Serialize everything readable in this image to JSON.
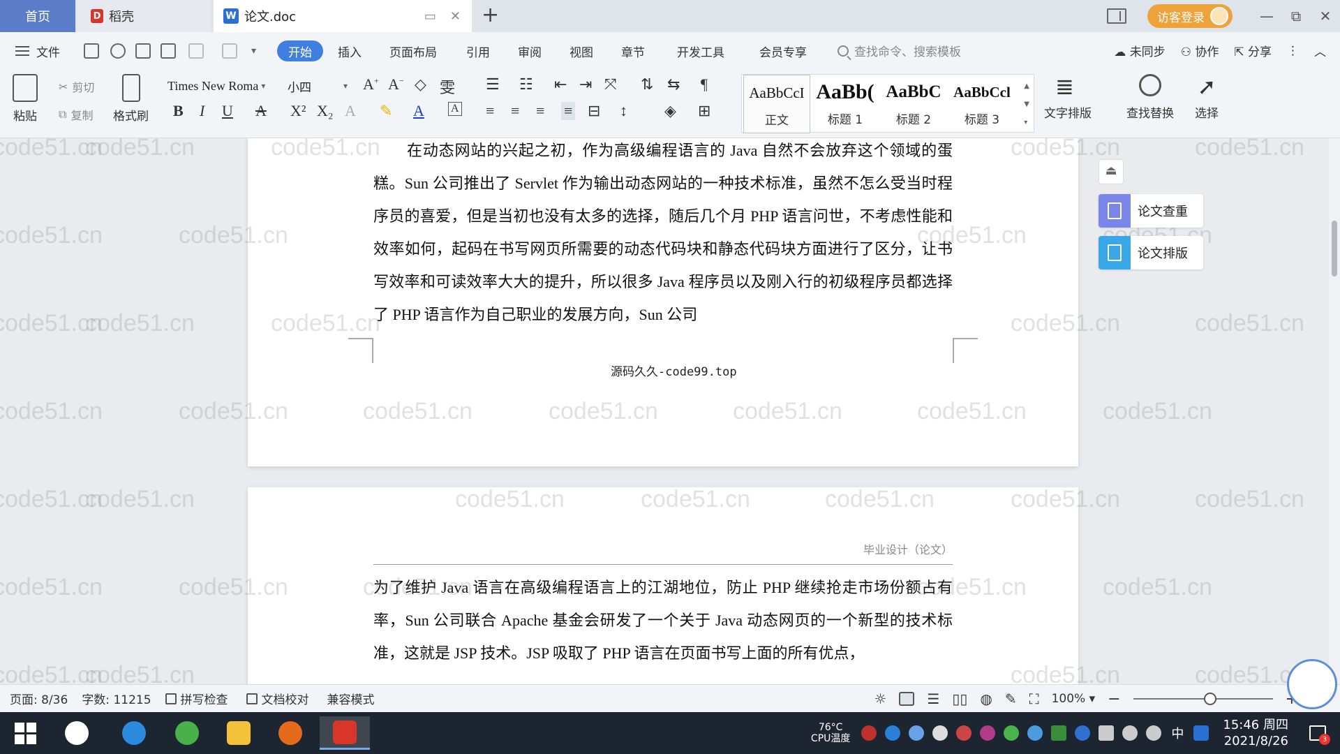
{
  "tabs": {
    "home": "首页",
    "daoke": "稻壳",
    "doc": "论文.doc",
    "new_tab": "+"
  },
  "titlebar": {
    "visitor_login": "访客登录",
    "minimize": "—",
    "restore": "⧉",
    "close": "✕"
  },
  "menu": {
    "file": "文件",
    "start": "开始",
    "insert": "插入",
    "page_layout": "页面布局",
    "references": "引用",
    "review": "审阅",
    "view": "视图",
    "chapter": "章节",
    "dev_tools": "开发工具",
    "member": "会员专享",
    "search_placeholder": "查找命令、搜索模板",
    "not_synced": "未同步",
    "collaborate": "协作",
    "share": "分享"
  },
  "ribbon": {
    "paste": "粘贴",
    "cut": "剪切",
    "copy": "复制",
    "format_painter": "格式刷",
    "font_name": "Times New Roma",
    "font_size": "小四",
    "bold": "B",
    "italic": "I",
    "underline": "U",
    "styles": [
      {
        "sample": "AaBbCcI",
        "label": "正文"
      },
      {
        "sample": "AaBb(",
        "label": "标题 1"
      },
      {
        "sample": "AaBbC",
        "label": "标题 2"
      },
      {
        "sample": "AaBbCcl",
        "label": "标题 3"
      }
    ],
    "text_layout": "文字排版",
    "find_replace": "查找替换",
    "select": "选择"
  },
  "document": {
    "page1_paragraph": "在动态网站的兴起之初，作为高级编程语言的 Java 自然不会放弃这个领域的蛋糕。Sun 公司推出了 Servlet 作为输出动态网站的一种技术标准，虽然不怎么受当时程序员的喜爱，但是当初也没有太多的选择，随后几个月 PHP 语言问世，不考虑性能和效率如何，起码在书写网页所需要的动态代码块和静态代码块方面进行了区分，让书写效率和可读效率大大的提升，所以很多 Java 程序员以及刚入行的初级程序员都选择了 PHP 语言作为自己职业的发展方向，Sun 公司",
    "page1_footer": "源码久久-code99.top",
    "page2_header": "毕业设计（论文）",
    "page2_paragraph": "为了维护 Java 语言在高级编程语言上的江湖地位，防止 PHP 继续抢走市场份额占有率，Sun 公司联合 Apache 基金会研发了一个关于 Java 动态网页的一个新型的技术标准，这就是 JSP 技术。JSP 吸取了 PHP 语言在页面书写上面的所有优点，",
    "watermark": "code51.cn"
  },
  "side_panel": {
    "check": "论文查重",
    "layout": "论文排版",
    "check_color": "#7b86e8",
    "layout_color": "#3aa8e6"
  },
  "statusbar": {
    "page": "页面: 8/36",
    "word_count": "字数: 11215",
    "spell_check": "拼写检查",
    "doc_proof": "文档校对",
    "compat_mode": "兼容模式",
    "zoom": "100%",
    "zoom_level": 0.55
  },
  "taskbar": {
    "cpu_temp": "76°C",
    "cpu_label": "CPU温度",
    "ime": "中",
    "time": "15:46 周四",
    "date": "2021/8/26",
    "notifications": "3"
  },
  "colors": {
    "accent": "#3f7fe0",
    "home_tab": "#5b7cc9",
    "login": "#f0a23a",
    "taskbar": "#1d2630"
  }
}
